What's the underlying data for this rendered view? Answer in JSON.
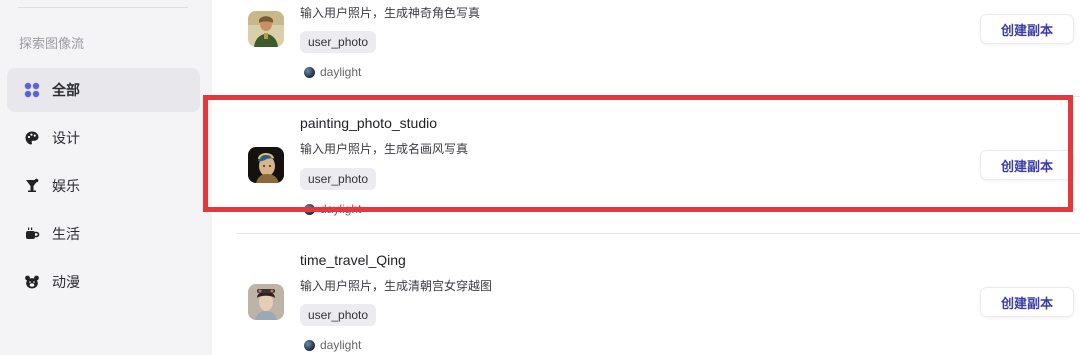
{
  "sidebar": {
    "section_label": "探索图像流",
    "items": [
      {
        "label": "全部",
        "icon": "grid-icon",
        "active": true
      },
      {
        "label": "设计",
        "icon": "palette-icon",
        "active": false
      },
      {
        "label": "娱乐",
        "icon": "cocktail-icon",
        "active": false
      },
      {
        "label": "生活",
        "icon": "coffee-cup-icon",
        "active": false
      },
      {
        "label": "动漫",
        "icon": "bear-icon",
        "active": false
      }
    ]
  },
  "workflows": [
    {
      "title": "",
      "description": "输入用户照片，生成神奇角色写真",
      "tag": "user_photo",
      "model": "daylight",
      "button": "创建副本"
    },
    {
      "title": "painting_photo_studio",
      "description": "输入用户照片，生成名画风写真",
      "tag": "user_photo",
      "model": "daylight",
      "button": "创建副本"
    },
    {
      "title": "time_travel_Qing",
      "description": "输入用户照片，生成清朝宫女穿越图",
      "tag": "user_photo",
      "model": "daylight",
      "button": "创建副本"
    }
  ],
  "colors": {
    "highlight": "#e5383b",
    "accent": "#3c3ca8",
    "active_nav": "#e7e7ec"
  }
}
